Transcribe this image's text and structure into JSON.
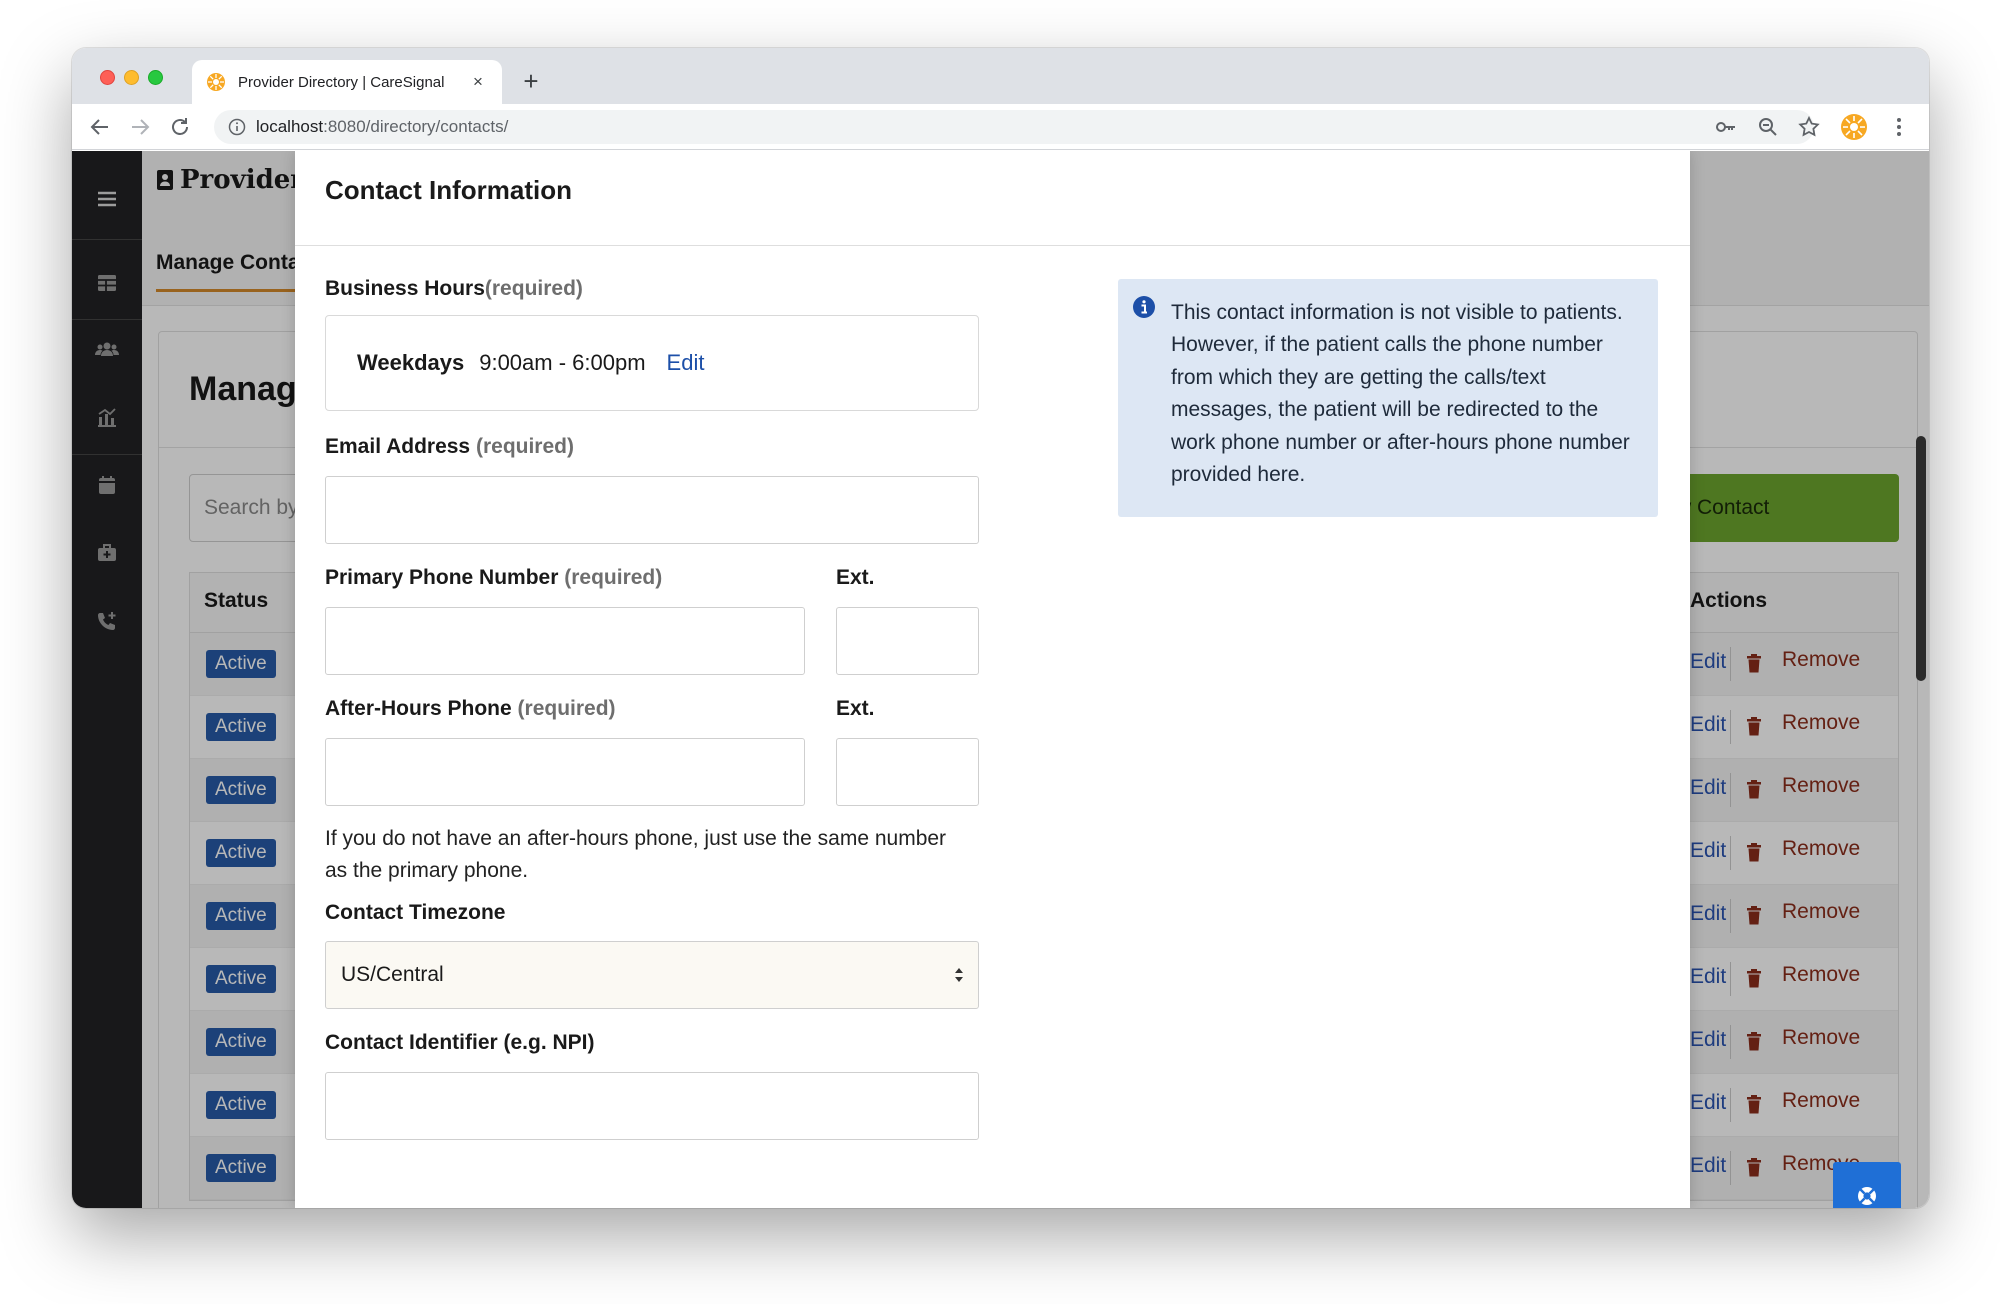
{
  "browser": {
    "tab_title": "Provider Directory | CareSignal",
    "tab_close": "×",
    "new_tab": "+",
    "url_host": "localhost",
    "url_path": ":8080/directory/contacts/"
  },
  "app": {
    "brand": "Provider Directory",
    "subnav_tab": "Manage Contacts",
    "panel_title": "Manage Contacts",
    "search_placeholder": "Search by name",
    "add_button": "+ Add New Contact",
    "table": {
      "status_header": "Status",
      "actions_header": "Actions",
      "edit_label": "Edit",
      "remove_label": "Remove",
      "rows": [
        "Active",
        "Active",
        "Active",
        "Active",
        "Active",
        "Active",
        "Active",
        "Active",
        "Active"
      ]
    }
  },
  "modal": {
    "title": "Contact Information",
    "business_hours": {
      "label": "Business Hours",
      "required": "(required)",
      "day": "Weekdays",
      "time": "9:00am - 6:00pm",
      "edit": "Edit"
    },
    "email": {
      "label": "Email Address",
      "required": "(required)",
      "value": ""
    },
    "primary_phone": {
      "label": "Primary Phone Number",
      "required": "(required)",
      "value": ""
    },
    "primary_ext": {
      "label": "Ext.",
      "value": ""
    },
    "after_hours_phone": {
      "label": "After-Hours Phone",
      "required": "(required)",
      "value": ""
    },
    "after_hours_ext": {
      "label": "Ext.",
      "value": ""
    },
    "after_hours_help": "If you do not have an after-hours phone, just use the same number as the primary phone.",
    "timezone": {
      "label": "Contact Timezone",
      "selected": "US/Central"
    },
    "identifier": {
      "label": "Contact Identifier (e.g. NPI)",
      "value": ""
    },
    "info_alert": "This contact information is not visible to patients. However, if the patient calls the phone number from which they are getting the calls/text messages, the patient will be redirected to the work phone number or after-hours phone number provided here."
  },
  "colors": {
    "accent_blue": "#1c4fa8",
    "badge_blue": "#275ba8",
    "add_green": "#6da52e",
    "remove_red": "#8b2d1b",
    "alert_bg": "#dde7f4",
    "fab_blue": "#1f6fd6"
  },
  "icons": {
    "sidebar": [
      "menu-icon",
      "table-icon",
      "users-icon",
      "analytics-icon",
      "calendar-icon",
      "medical-bag-icon",
      "phone-plus-icon"
    ],
    "toolbar": [
      "back-icon",
      "forward-icon",
      "reload-icon",
      "key-icon",
      "zoom-icon",
      "star-icon",
      "profile-icon",
      "more-icon"
    ]
  }
}
